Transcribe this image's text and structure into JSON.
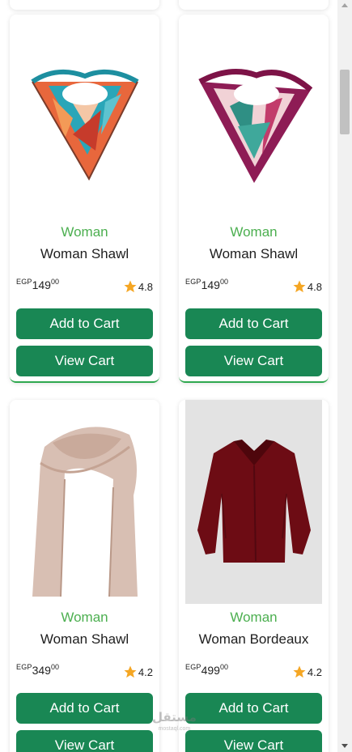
{
  "products": [
    {
      "category": "Woman",
      "name": "Woman Shawl",
      "currency": "EGP",
      "price_main": "149",
      "price_cents": "00",
      "rating": "4.8",
      "add_label": "Add to Cart",
      "view_label": "View Cart",
      "image": "scarf-orange-icon"
    },
    {
      "category": "Woman",
      "name": "Woman Shawl",
      "currency": "EGP",
      "price_main": "149",
      "price_cents": "00",
      "rating": "4.8",
      "add_label": "Add to Cart",
      "view_label": "View Cart",
      "image": "scarf-pink-icon"
    },
    {
      "category": "Woman",
      "name": "Woman Shawl",
      "currency": "EGP",
      "price_main": "349",
      "price_cents": "00",
      "rating": "4.2",
      "add_label": "Add to Cart",
      "view_label": "View Cart",
      "image": "scarf-beige-icon"
    },
    {
      "category": "Woman",
      "name": "Woman Bordeaux",
      "currency": "EGP",
      "price_main": "499",
      "price_cents": "00",
      "rating": "4.2",
      "add_label": "Add to Cart",
      "view_label": "View Cart",
      "image": "shirt-bordeaux-icon"
    }
  ],
  "watermark": {
    "text": "مستقل",
    "sub": "mostaql.com"
  },
  "colors": {
    "accent": "#198754",
    "category": "#4caf50",
    "star": "#f5a623",
    "hover_border": "#2fa84f"
  }
}
